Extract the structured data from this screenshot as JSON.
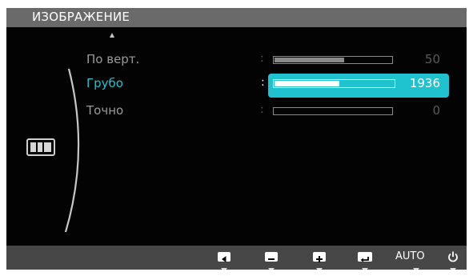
{
  "title": "ИЗОБРАЖЕНИЕ",
  "rows": [
    {
      "label": "По верт.",
      "colon": ":",
      "value": "50",
      "percent": 60
    },
    {
      "label": "Грубо",
      "colon": ":",
      "value": "1936",
      "percent": 55
    },
    {
      "label": "Точно",
      "colon": ":",
      "value": "0",
      "percent": 0
    }
  ],
  "bottom": {
    "auto_label": "AUTO",
    "buttons": [
      "left-arrow-icon",
      "minus-icon",
      "plus-icon",
      "enter-icon",
      "auto",
      "power-icon"
    ]
  },
  "colors": {
    "accent": "#1ec3cf",
    "title_bar": "#6a6a6a",
    "bottom_bar": "#474747",
    "background": "#030303"
  }
}
